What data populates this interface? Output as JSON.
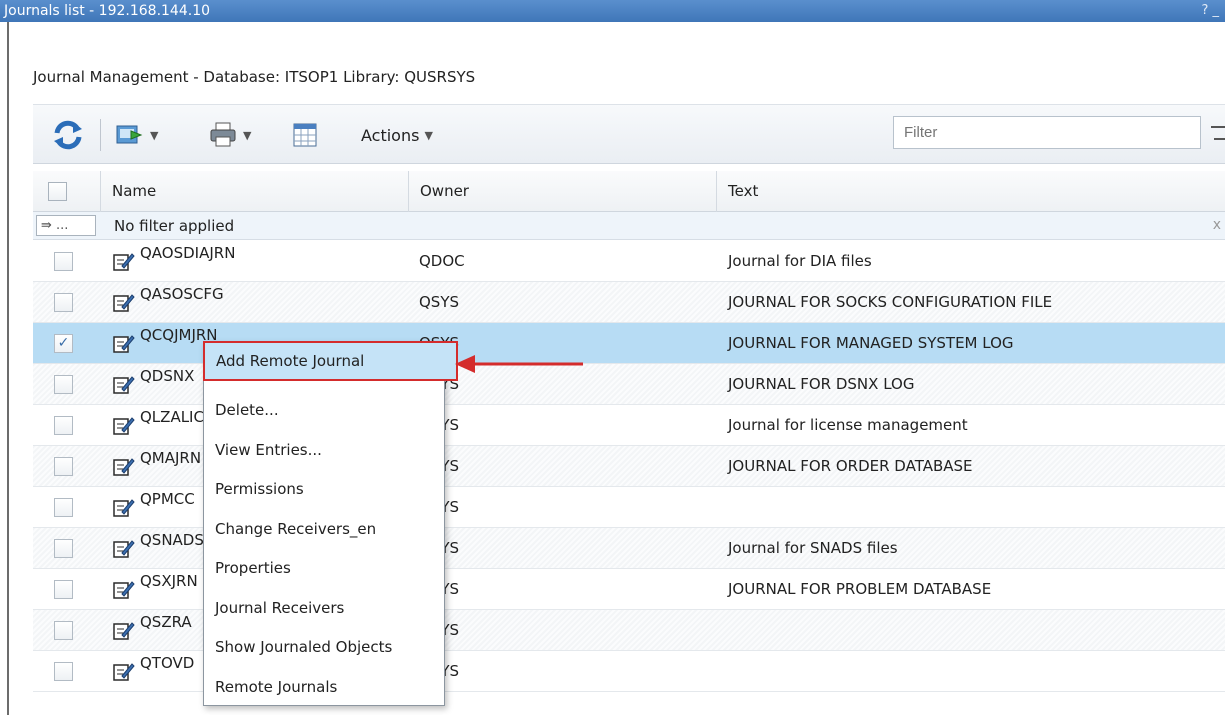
{
  "window": {
    "title": "Journals list - 192.168.144.10",
    "controls": "? _"
  },
  "heading": "Journal Management - Database: ITSOP1 Library: QUSRSYS",
  "toolbar": {
    "actions_label": "Actions",
    "filter_placeholder": "Filter",
    "icons": [
      "refresh-icon",
      "export-icon",
      "print-icon",
      "table-config-icon",
      "apply-filter-icon"
    ]
  },
  "grid": {
    "columns": [
      "Name",
      "Owner",
      "Text"
    ],
    "filter_status": "No filter applied",
    "filter_tag": "...",
    "clear_label": "x",
    "rows": [
      {
        "name": "QAOSDIAJRN",
        "owner": "QDOC",
        "text": "Journal for DIA files",
        "checked": false
      },
      {
        "name": "QASOSCFG",
        "owner": "QSYS",
        "text": "JOURNAL FOR SOCKS CONFIGURATION FILE",
        "checked": false
      },
      {
        "name": "QCQJMJRN",
        "owner": "QSYS",
        "text": "JOURNAL FOR MANAGED SYSTEM LOG",
        "checked": true
      },
      {
        "name": "QDSNX",
        "owner": "QSYS",
        "text": "JOURNAL FOR DSNX LOG",
        "checked": false
      },
      {
        "name": "QLZALIC",
        "owner": "QSYS",
        "text": "Journal for license management",
        "checked": false
      },
      {
        "name": "QMAJRN",
        "owner": "QSYS",
        "text": "JOURNAL FOR ORDER DATABASE",
        "checked": false
      },
      {
        "name": "QPMCC",
        "owner": "QSYS",
        "text": "",
        "checked": false
      },
      {
        "name": "QSNADS",
        "owner": "QSYS",
        "text": "Journal for SNADS files",
        "checked": false
      },
      {
        "name": "QSXJRN",
        "owner": "QSYS",
        "text": "JOURNAL FOR PROBLEM DATABASE",
        "checked": false
      },
      {
        "name": "QSZRA",
        "owner": "QSYS",
        "text": "",
        "checked": false
      },
      {
        "name": "QTOVD",
        "owner": "QSYS",
        "text": "",
        "checked": false
      }
    ]
  },
  "context_menu": {
    "items": [
      "Add Remote Journal",
      "Delete...",
      "View Entries...",
      "Permissions",
      "Change Receivers_en",
      "Properties",
      "Journal Receivers",
      "Show Journaled Objects",
      "Remote Journals"
    ],
    "highlighted": "Add Remote Journal"
  },
  "colors": {
    "title_bar": "#3f76b8",
    "selected_row": "#b7dcf4",
    "callout": "#d42c2c"
  }
}
